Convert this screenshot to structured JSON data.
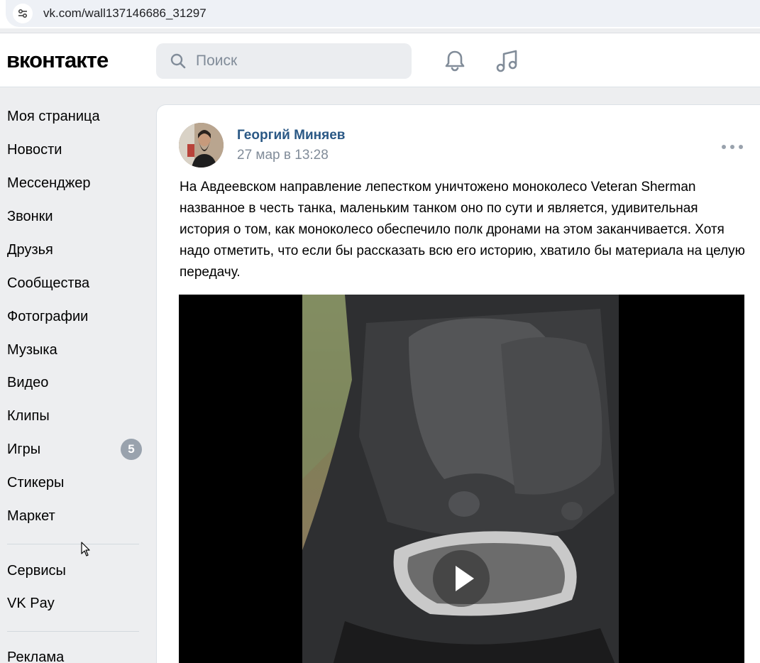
{
  "browser": {
    "url": "vk.com/wall137146686_31297"
  },
  "header": {
    "logo": "вконтакте",
    "search": {
      "placeholder": "Поиск"
    }
  },
  "sidebar": {
    "items": [
      {
        "label": "Моя страница"
      },
      {
        "label": "Новости"
      },
      {
        "label": "Мессенджер"
      },
      {
        "label": "Звонки"
      },
      {
        "label": "Друзья"
      },
      {
        "label": "Сообщества"
      },
      {
        "label": "Фотографии"
      },
      {
        "label": "Музыка"
      },
      {
        "label": "Видео"
      },
      {
        "label": "Клипы"
      },
      {
        "label": "Игры",
        "badge": "5"
      },
      {
        "label": "Стикеры"
      },
      {
        "label": "Маркет"
      }
    ],
    "secondary": [
      {
        "label": "Сервисы"
      },
      {
        "label": "VK Pay"
      }
    ],
    "tertiary": [
      {
        "label": "Реклама"
      }
    ]
  },
  "post": {
    "author": "Георгий Миняев",
    "date": "27 мар в 13:28",
    "text": "На Авдеевском направление лепестком уничтожено моноколесо Veteran Sherman названное в честь танка, маленьким танком оно по сути и является, удивительная история о том, как моноколесо обеспечило полк дронами на этом заканчивается. Хотя надо отметить, что если бы рассказать всю его историю, хватило бы материала на целую передачу."
  }
}
